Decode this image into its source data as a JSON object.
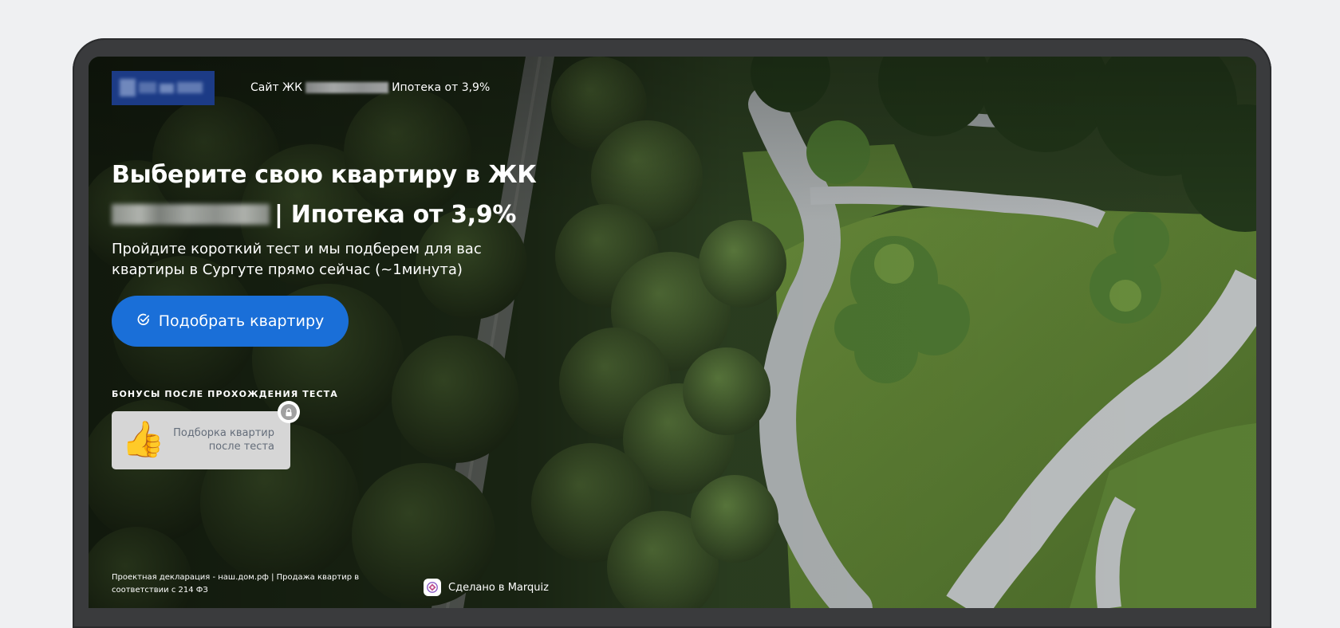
{
  "header": {
    "site_prefix": "Сайт ЖК",
    "mortgage_note": "Ипотека от 3,9%"
  },
  "hero": {
    "title_line1": "Выберите свою квартиру в ЖК",
    "title_line2_suffix": "| Ипотека от 3,9%",
    "subtitle": "Пройдите короткий тест и мы подберем для вас квартиры в Сургуте прямо сейчас (~1минута)",
    "cta_label": "Подобрать квартиру"
  },
  "bonuses": {
    "title": "БОНУСЫ ПОСЛЕ ПРОХОЖДЕНИЯ ТЕСТА",
    "items": [
      {
        "label": "Подборка квартир после теста",
        "icon": "thumbs-up-icon",
        "locked": true
      }
    ]
  },
  "footer": {
    "legal_text": "Проектная декларация - наш.дом.рф | Продажа квартир в соответствии с 214 ФЗ",
    "made_by": "Сделано в Marquiz"
  },
  "colors": {
    "accent": "#1a6fd8",
    "logo_bg": "#1c3b86",
    "page_bg": "#eff0f2",
    "frame": "#3a3b3d"
  }
}
